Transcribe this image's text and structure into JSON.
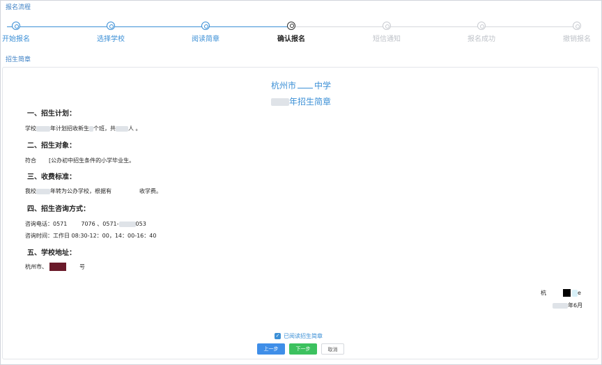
{
  "flow": {
    "title": "报名流程",
    "steps": [
      {
        "label": "开始报名",
        "state": "done"
      },
      {
        "label": "选择学校",
        "state": "done"
      },
      {
        "label": "阅读简章",
        "state": "done"
      },
      {
        "label": "确认报名",
        "state": "current"
      },
      {
        "label": "短信通知",
        "state": "todo"
      },
      {
        "label": "报名成功",
        "state": "todo"
      },
      {
        "label": "撤销报名",
        "state": "todo"
      }
    ]
  },
  "doc": {
    "section_title": "招生简章",
    "school_name": "杭州市",
    "school_suffix": "中学",
    "heading": "年招生简章",
    "s1_title": "一、招生计划：",
    "s1_text_a": "学校",
    "s1_text_b": "年计划招收新生",
    "s1_text_c": "个班，共",
    "s1_text_d": "人 。",
    "s2_title": "二、招生对象：",
    "s2_text_a": "符合",
    "s2_text_b": "[公办初中招生条件的小学毕业生。",
    "s3_title": "三、收费标准：",
    "s3_text_a": "我校",
    "s3_text_b": "年转为公办学校，根据有",
    "s3_text_c": "收学费。",
    "s4_title": "四、招生咨询方式：",
    "phone_label": "咨询电话：0571",
    "phone_rest": "7076 、0571-",
    "phone_end": "053",
    "hours_text": "咨询时间：工作日 08:30-12：00，14：00-16：40",
    "s5_title": "五、学校地址：",
    "address_a": "杭州市、",
    "address_b": "号",
    "sign_a": "杭",
    "sign_b": "e",
    "date_suffix": "年6月"
  },
  "footer": {
    "read_checkbox_label": "已阅读招生简章",
    "read_checked": true,
    "prev_label": "上一步",
    "next_label": "下一步",
    "cancel_label": "取消"
  },
  "colors": {
    "accent": "#3b8fd6",
    "prev_button": "#3f8ee8",
    "next_button": "#3cc15f",
    "pending": "#bfc3c9"
  }
}
